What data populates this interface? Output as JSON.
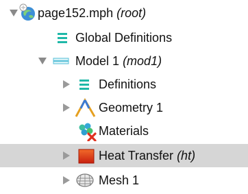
{
  "tree": {
    "root": {
      "name": "page152.mph",
      "tag": "(root)",
      "expanded": true,
      "icon": "model-root-icon"
    },
    "items": [
      {
        "id": "global-definitions",
        "label": "Global Definitions",
        "tag": "",
        "level": 1,
        "has_children": false,
        "icon": "definitions-list-icon"
      },
      {
        "id": "model-1",
        "label": "Model 1",
        "tag": "(mod1)",
        "level": 1,
        "expanded": true,
        "icon": "model-component-icon"
      },
      {
        "id": "definitions",
        "label": "Definitions",
        "tag": "",
        "level": 2,
        "expanded": false,
        "icon": "definitions-list-icon"
      },
      {
        "id": "geometry-1",
        "label": "Geometry 1",
        "tag": "",
        "level": 2,
        "expanded": false,
        "icon": "geometry-icon"
      },
      {
        "id": "materials",
        "label": "Materials",
        "tag": "",
        "level": 2,
        "has_children": false,
        "icon": "materials-icon"
      },
      {
        "id": "heat-transfer",
        "label": "Heat Transfer",
        "tag": "(ht)",
        "level": 2,
        "expanded": false,
        "selected": true,
        "icon": "heat-transfer-icon"
      },
      {
        "id": "mesh-1",
        "label": "Mesh 1",
        "tag": "",
        "level": 2,
        "expanded": false,
        "icon": "mesh-icon"
      }
    ]
  },
  "colors": {
    "selection_bg": "#d6d6d6",
    "twisty": "#8a8a8a",
    "definitions_icon": "#1fb8a8",
    "heat_icon": "#e8401c",
    "model_icon": "#58c0d8"
  }
}
